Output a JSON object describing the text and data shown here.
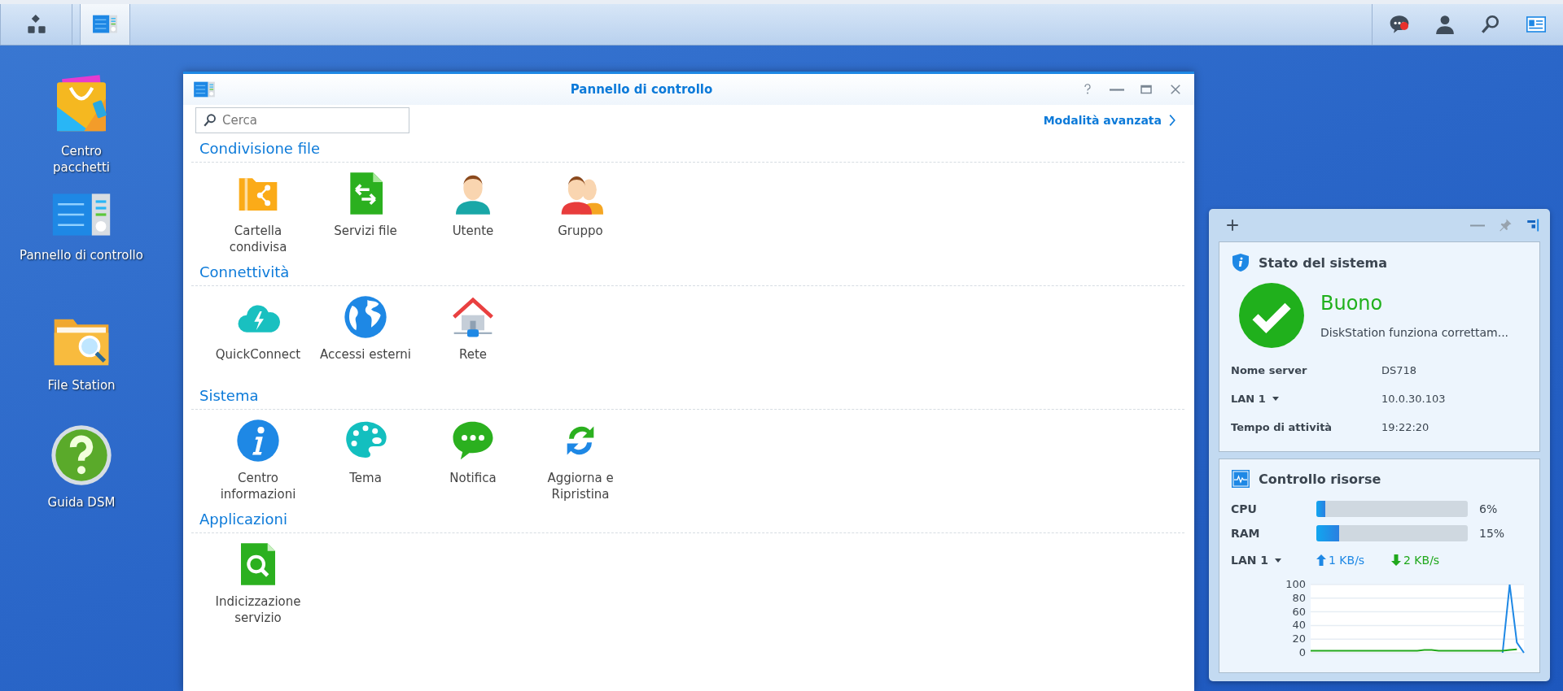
{
  "taskbar": {
    "buttons": [
      {
        "kind": "main-menu",
        "selected": false
      },
      {
        "kind": "control-panel",
        "selected": true
      }
    ],
    "tray": [
      {
        "kind": "notifications",
        "unread": true
      },
      {
        "kind": "user",
        "unread": false
      },
      {
        "kind": "search",
        "unread": false
      },
      {
        "kind": "widgets",
        "unread": false
      }
    ]
  },
  "desktop_icons": [
    {
      "label": "Centro pacchetti",
      "kind": "package-center"
    },
    {
      "label": "Pannello di controllo",
      "kind": "control-panel"
    },
    {
      "label": "File Station",
      "kind": "file-station"
    },
    {
      "label": "Guida DSM",
      "kind": "help"
    }
  ],
  "window": {
    "title": "Pannello di controllo",
    "search": {
      "placeholder": "Cerca"
    },
    "advanced_link": "Modalità avanzata",
    "sections": [
      {
        "title": "Condivisione file",
        "items": [
          {
            "label": "Cartella condivisa",
            "kind": "shared-folder"
          },
          {
            "label": "Servizi file",
            "kind": "file-services"
          },
          {
            "label": "Utente",
            "kind": "user"
          },
          {
            "label": "Gruppo",
            "kind": "group"
          }
        ]
      },
      {
        "title": "Connettività",
        "items": [
          {
            "label": "QuickConnect",
            "kind": "quickconnect"
          },
          {
            "label": "Accessi esterni",
            "kind": "external-access"
          },
          {
            "label": "Rete",
            "kind": "network"
          }
        ]
      },
      {
        "title": "Sistema",
        "items": [
          {
            "label": "Centro informazioni",
            "kind": "info-center"
          },
          {
            "label": "Tema",
            "kind": "theme"
          },
          {
            "label": "Notifica",
            "kind": "notification"
          },
          {
            "label": "Aggiorna e Ripristina",
            "kind": "update"
          }
        ]
      },
      {
        "title": "Applicazioni",
        "items": [
          {
            "label": "Indicizzazione servizio",
            "kind": "indexing"
          }
        ]
      }
    ]
  },
  "widgets": {
    "system_health": {
      "title": "Stato del sistema",
      "status": "Buono",
      "message": "DiskStation funziona correttam...",
      "rows": [
        {
          "label": "Nome server",
          "value": "DS718",
          "kind": "plain"
        },
        {
          "label": "LAN 1",
          "value": "10.0.30.103",
          "kind": "dropdown"
        },
        {
          "label": "Tempo di attività",
          "value": "19:22:20",
          "kind": "plain"
        }
      ]
    },
    "resource_monitor": {
      "title": "Controllo risorse",
      "meters": [
        {
          "name": "CPU",
          "level": 0.06,
          "reading": "6%"
        },
        {
          "name": "RAM",
          "level": 0.15,
          "reading": "15%"
        }
      ],
      "network": {
        "interface": "LAN 1",
        "upload": "1 KB/s",
        "download": "2 KB/s"
      },
      "chart_data": {
        "type": "line",
        "ylim": [
          0,
          100
        ],
        "yticks": [
          0,
          20,
          40,
          60,
          80,
          100
        ],
        "grid": true,
        "series": [
          {
            "color": "#1e88e5",
            "values": [
              null,
              null,
              null,
              null,
              null,
              null,
              null,
              null,
              null,
              null,
              null,
              null,
              null,
              null,
              null,
              null,
              null,
              null,
              null,
              null,
              null,
              null,
              null,
              null,
              null,
              null,
              null,
              0,
              100,
              15,
              0
            ]
          },
          {
            "color": "#20a81c",
            "values": [
              3,
              3,
              3,
              3,
              3,
              3,
              3,
              3,
              3,
              3,
              3,
              3,
              3,
              3,
              3,
              3,
              4,
              4,
              3,
              3,
              3,
              3,
              3,
              3,
              3,
              3,
              3,
              3,
              4,
              5,
              null
            ]
          }
        ]
      }
    }
  }
}
